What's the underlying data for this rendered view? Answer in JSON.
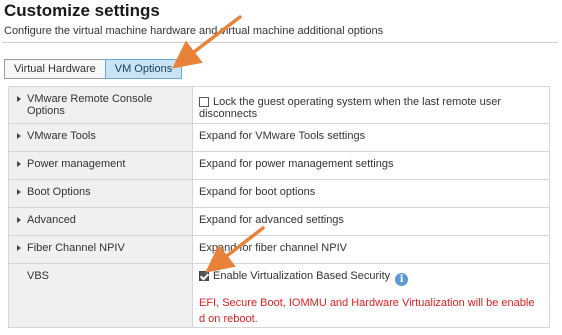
{
  "header": {
    "title": "Customize settings",
    "subtitle": "Configure the virtual machine hardware and virtual machine additional options"
  },
  "tabs": [
    {
      "label": "Virtual Hardware",
      "active": false
    },
    {
      "label": "VM Options",
      "active": true
    }
  ],
  "options": {
    "remote_console": {
      "label": "VMware Remote Console Options",
      "checkbox_label": "Lock the guest operating system when the last remote user disconnects",
      "checked": false
    },
    "vmware_tools": {
      "label": "VMware Tools",
      "value": "Expand for VMware Tools settings"
    },
    "power_management": {
      "label": "Power management",
      "value": "Expand for power management settings"
    },
    "boot_options": {
      "label": "Boot Options",
      "value": "Expand for boot options"
    },
    "advanced": {
      "label": "Advanced",
      "value": "Expand for advanced settings"
    },
    "fiber_channel": {
      "label": "Fiber Channel NPIV",
      "value": "Expand for fiber channel NPIV"
    },
    "vbs": {
      "label": "VBS",
      "checkbox_label": "Enable Virtualization Based Security",
      "checked": true,
      "info_icon": "i",
      "warning": "EFI, Secure Boot, IOMMU and Hardware Virtualization will be enabled on reboot."
    }
  },
  "colors": {
    "accent_tab": "#c8e3f5",
    "warning_text": "#e02020",
    "annotation_arrow": "#e8813a"
  },
  "icons": [
    "caret-right-icon",
    "info-icon",
    "annotation-arrow-icon"
  ]
}
